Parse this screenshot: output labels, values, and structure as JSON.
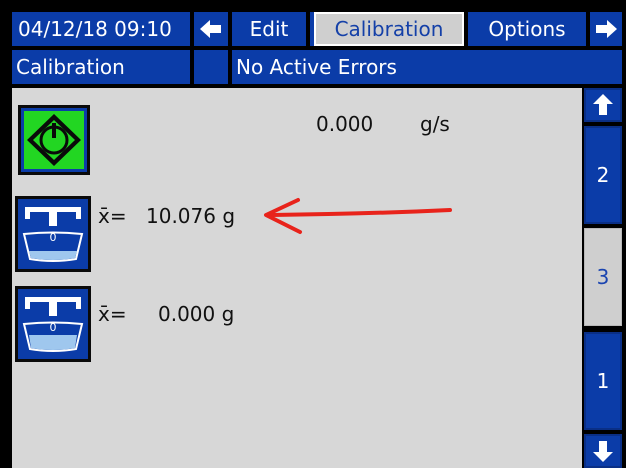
{
  "header": {
    "datetime": "04/12/18 09:10",
    "tabs": [
      "Edit",
      "Calibration",
      "Options"
    ],
    "active_tab": "Calibration",
    "left_arrow_icon": "arrow-left-icon",
    "right_arrow_icon": "arrow-right-icon"
  },
  "status": {
    "screen_name": "Calibration",
    "message": "No Active Errors"
  },
  "main": {
    "flow_value": "0.000",
    "flow_unit": "g/s",
    "start_icon": "start-diamond-icon",
    "scale_icon": "scale-icon",
    "annotation_color": "#e8231b",
    "readings": [
      {
        "label": "x̄=",
        "value": "10.076 g"
      },
      {
        "label": "x̄=",
        "value": "0.000 g"
      }
    ]
  },
  "side_nav": {
    "up_icon": "arrow-up-icon",
    "down_icon": "arrow-down-icon",
    "pages": [
      "2",
      "3",
      "1"
    ],
    "active_page": "3"
  },
  "colors": {
    "bar_blue": "#0b3ca8",
    "active_tab_gray": "#cfcfcf",
    "start_green": "#22d622"
  }
}
